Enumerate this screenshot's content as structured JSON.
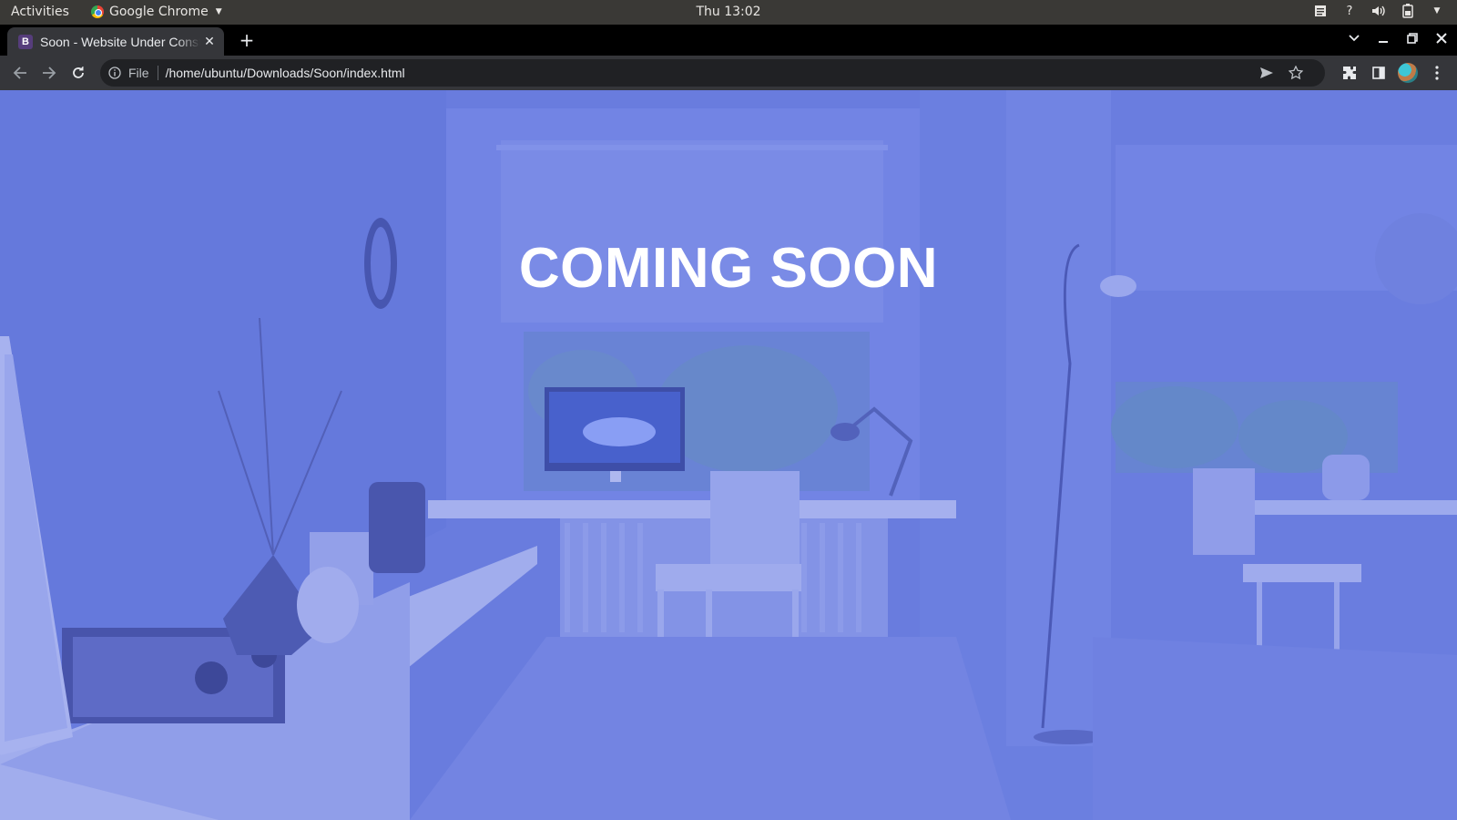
{
  "system_bar": {
    "activities": "Activities",
    "app_name": "Google Chrome",
    "clock": "Thu 13:02"
  },
  "browser": {
    "tab": {
      "favicon_letter": "B",
      "title": "Soon - Website Under Construction"
    },
    "omnibox": {
      "scheme_label": "File",
      "url": "/home/ubuntu/Downloads/Soon/index.html"
    }
  },
  "page": {
    "headline": "COMING SOON"
  },
  "colors": {
    "overlay_tint": "#6b7fe0",
    "headline": "#ffffff",
    "favicon_bg": "#563d7c"
  }
}
